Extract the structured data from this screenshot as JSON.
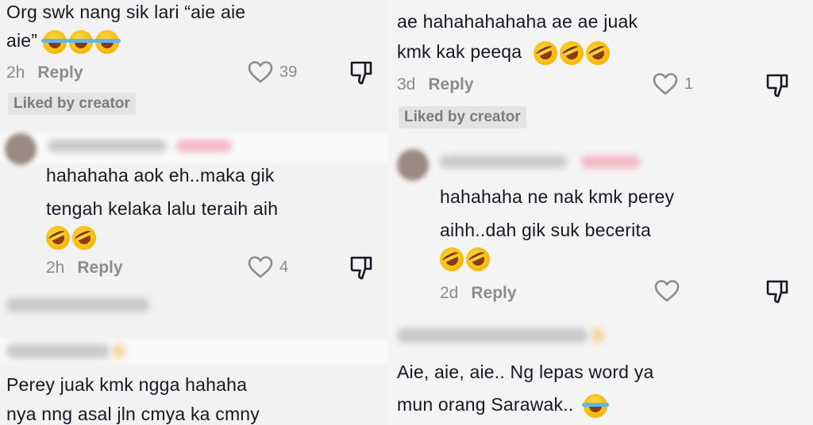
{
  "left": {
    "comment1": {
      "line1": "Org swk nang sik lari “aie aie",
      "line2": "aie”",
      "time": "2h",
      "reply": "Reply",
      "likes": "39",
      "badge": "Liked by creator"
    },
    "reply1": {
      "line1": "hahahaha aok eh..maka gik",
      "line2": "tengah kelaka lalu teraih aih",
      "time": "2h",
      "reply": "Reply",
      "likes": "4"
    },
    "comment2": {
      "line1": "Perey juak kmk ngga hahaha",
      "line2": "nya nng asal jln cmya ka cmny"
    }
  },
  "right": {
    "comment1": {
      "line1": "ae hahahahahaha ae ae juak",
      "line2": "kmk kak peeqa",
      "time": "3d",
      "reply": "Reply",
      "likes": "1",
      "badge": "Liked by creator"
    },
    "reply1": {
      "line1": "hahahaha ne nak kmk perey",
      "line2": "aihh..dah gik suk becerita",
      "time": "2d",
      "reply": "Reply"
    },
    "comment2": {
      "line1": "Aie, aie, aie.. Ng lepas word ya",
      "line2": "mun orang Sarawak.."
    }
  },
  "icons": {
    "like": "heart-outline-icon",
    "dislike": "thumbs-down-icon",
    "emoji_cry": "face-with-tears-of-joy-emoji",
    "emoji_rofl": "rolling-on-floor-laughing-emoji"
  },
  "colors": {
    "text": "#161823",
    "meta": "#8a8b91",
    "badge_bg": "#e3e3e3",
    "background": "#f2f2f2"
  }
}
